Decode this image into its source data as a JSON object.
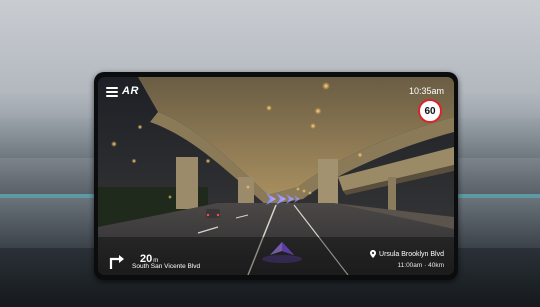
{
  "hud": {
    "ar_label": "AR",
    "time": "10:35am",
    "speed_limit": "60",
    "distance_value": "20",
    "distance_unit": "m",
    "street": "South San Vicente Blvd",
    "destination": "Ursula Brooklyn Blvd",
    "eta": "11:00am · 40km"
  },
  "icons": {
    "menu": "hamburger-menu-icon",
    "turn": "turn-right-arrow-icon",
    "pin": "location-pin-icon",
    "ar_chevrons": "ar-direction-chevrons",
    "ar_marker": "ar-position-marker"
  },
  "colors": {
    "speed_sign_border": "#d8242b",
    "ar_accent": "#8a5cff"
  }
}
